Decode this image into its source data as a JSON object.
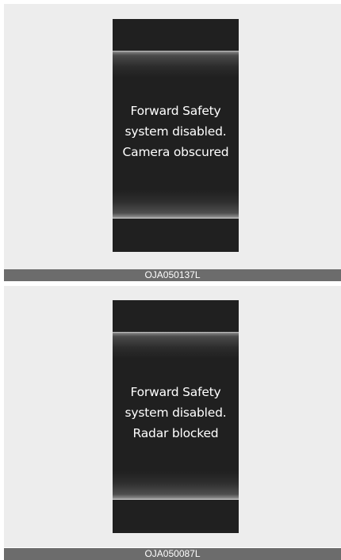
{
  "figures": [
    {
      "message_lines": [
        "Forward Safety",
        "system disabled.",
        "Camera obscured"
      ],
      "caption": "OJA050137L"
    },
    {
      "message_lines": [
        "Forward Safety",
        "system disabled.",
        "Radar blocked"
      ],
      "caption": "OJA050087L"
    }
  ]
}
